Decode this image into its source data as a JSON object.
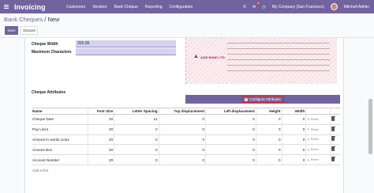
{
  "navbar": {
    "app_name": "Invoicing",
    "menu": [
      "Customers",
      "Vendors",
      "Bank Cheque",
      "Reporting",
      "Configuration"
    ],
    "chat_count": "4",
    "company": "My Company (San Francisco)",
    "user": "Mitchell Admin"
  },
  "breadcrumb": {
    "parent": "Bank Cheques",
    "separator": " / ",
    "current": "New"
  },
  "actions": {
    "save": "Save",
    "discard": "Discard"
  },
  "fields": {
    "cheque_width_label": "Cheque Width",
    "cheque_width_value": "203.00",
    "max_chars_label": "Maximum Characters",
    "max_chars_value": ""
  },
  "cheque_preview": {
    "bank_name": "AXIS BANK LTD."
  },
  "attributes": {
    "section_title": "Cheque Attributes",
    "configure_label": "Configure Attributes",
    "columns": [
      "Name",
      "Font Size",
      "Letter Spacing",
      "Top displacement",
      "Left displacement",
      "Height",
      "Width"
    ],
    "rows": [
      {
        "name": "Cheque Date",
        "font_size": "20",
        "letter_spacing": "12",
        "top": "0",
        "left": "0",
        "height": "0",
        "width": "0",
        "action": "Reset"
      },
      {
        "name": "Pay Line1",
        "font_size": "20",
        "letter_spacing": "0",
        "top": "0",
        "left": "0",
        "height": "0",
        "width": "0",
        "action": "Reset"
      },
      {
        "name": "Amount In words Line1",
        "font_size": "20",
        "letter_spacing": "0",
        "top": "0",
        "left": "0",
        "height": "0",
        "width": "0",
        "action": "Reset"
      },
      {
        "name": "Amount Box",
        "font_size": "20",
        "letter_spacing": "0",
        "top": "0",
        "left": "0",
        "height": "0",
        "width": "0",
        "action": "Reset"
      },
      {
        "name": "Account Number",
        "font_size": "20",
        "letter_spacing": "0",
        "top": "0",
        "left": "0",
        "height": "0",
        "width": "0",
        "action": "Reset"
      }
    ],
    "add_line": "Add a line"
  },
  "colors": {
    "brand": "#71639e",
    "highlight": "#e02020"
  }
}
